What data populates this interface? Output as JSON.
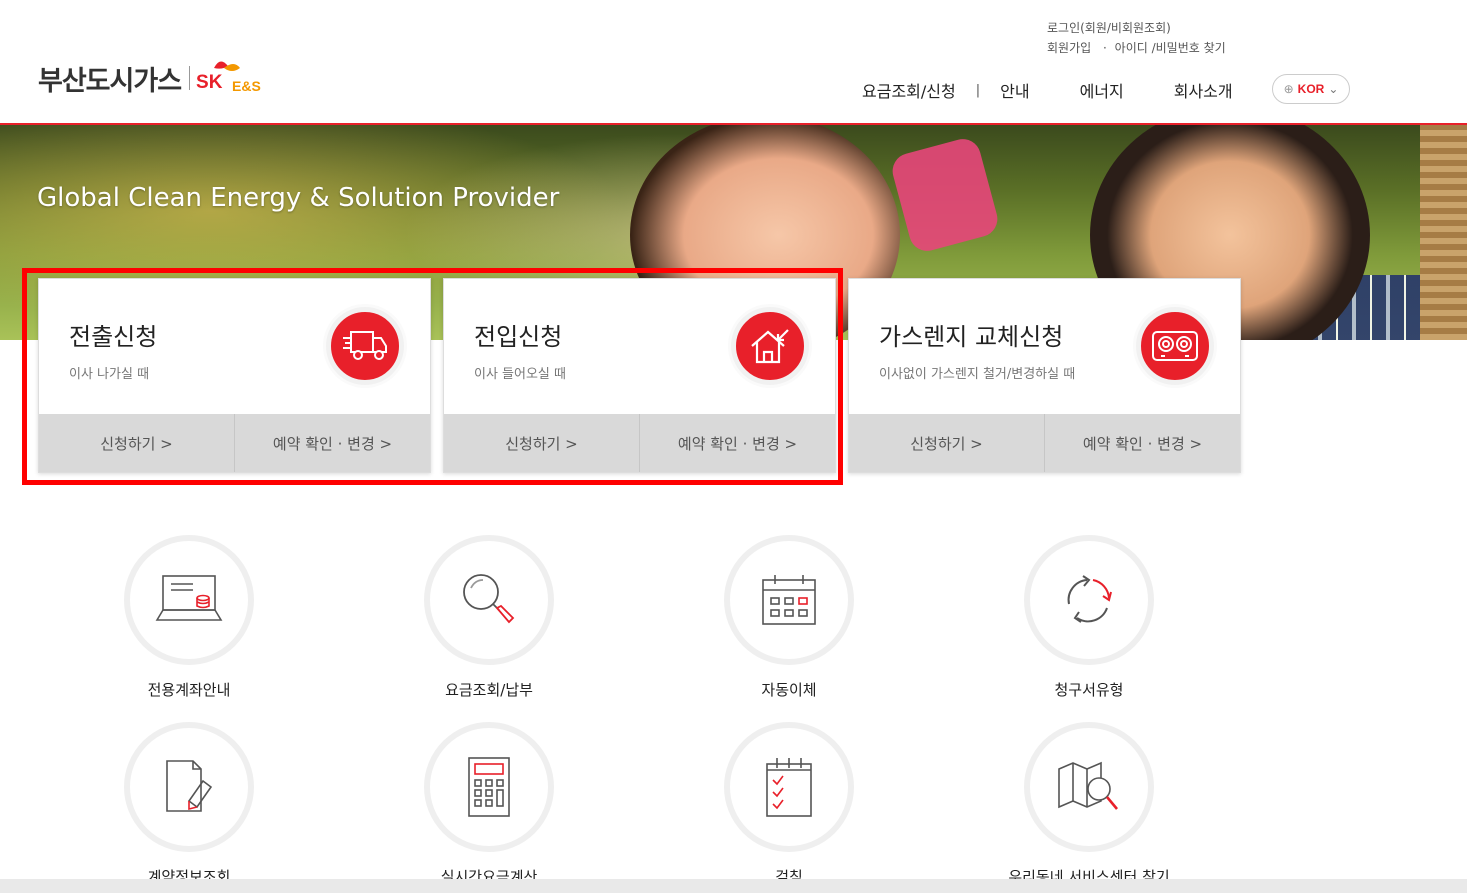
{
  "header": {
    "logo_text": "부산도시가스",
    "logo_sk": "SK",
    "logo_es": "E&S",
    "util_line1": "로그인(회원/비회원조회)",
    "util_join": "회원가입",
    "util_find": "아이디 /비밀번호 찾기",
    "util_dot": "·",
    "nav": [
      "요금조회/신청",
      "안내",
      "에너지",
      "회사소개"
    ],
    "nav_sep": "|",
    "lang": "KOR"
  },
  "hero": {
    "title": "Global Clean Energy & Solution Provider"
  },
  "cards": [
    {
      "title": "전출신청",
      "sub": "이사 나가실 때",
      "apply": "신청하기 >",
      "check": "예약 확인 · 변경 >",
      "icon": "moving-truck-icon"
    },
    {
      "title": "전입신청",
      "sub": "이사 들어오실 때",
      "apply": "신청하기 >",
      "check": "예약 확인 · 변경 >",
      "icon": "house-move-in-icon"
    },
    {
      "title": "가스렌지 교체신청",
      "sub": "이사없이 가스렌지 철거/변경하실 때",
      "apply": "신청하기 >",
      "check": "예약 확인 · 변경 >",
      "icon": "gas-range-icon"
    }
  ],
  "quick_menu": [
    {
      "label": "전용계좌안내",
      "icon": "laptop-account-icon"
    },
    {
      "label": "요금조회/납부",
      "icon": "magnifier-icon"
    },
    {
      "label": "자동이체",
      "icon": "calendar-icon"
    },
    {
      "label": "청구서유형",
      "icon": "cycle-icon"
    },
    {
      "label": "계약정보조회",
      "icon": "document-pen-icon"
    },
    {
      "label": "실시간요금계산",
      "icon": "calculator-icon"
    },
    {
      "label": "검침",
      "icon": "checklist-icon"
    },
    {
      "label": "우리동네 서비스센터 찾기",
      "icon": "map-search-icon"
    }
  ],
  "colors": {
    "accent": "#e8202a",
    "highlight": "#ff0000"
  }
}
